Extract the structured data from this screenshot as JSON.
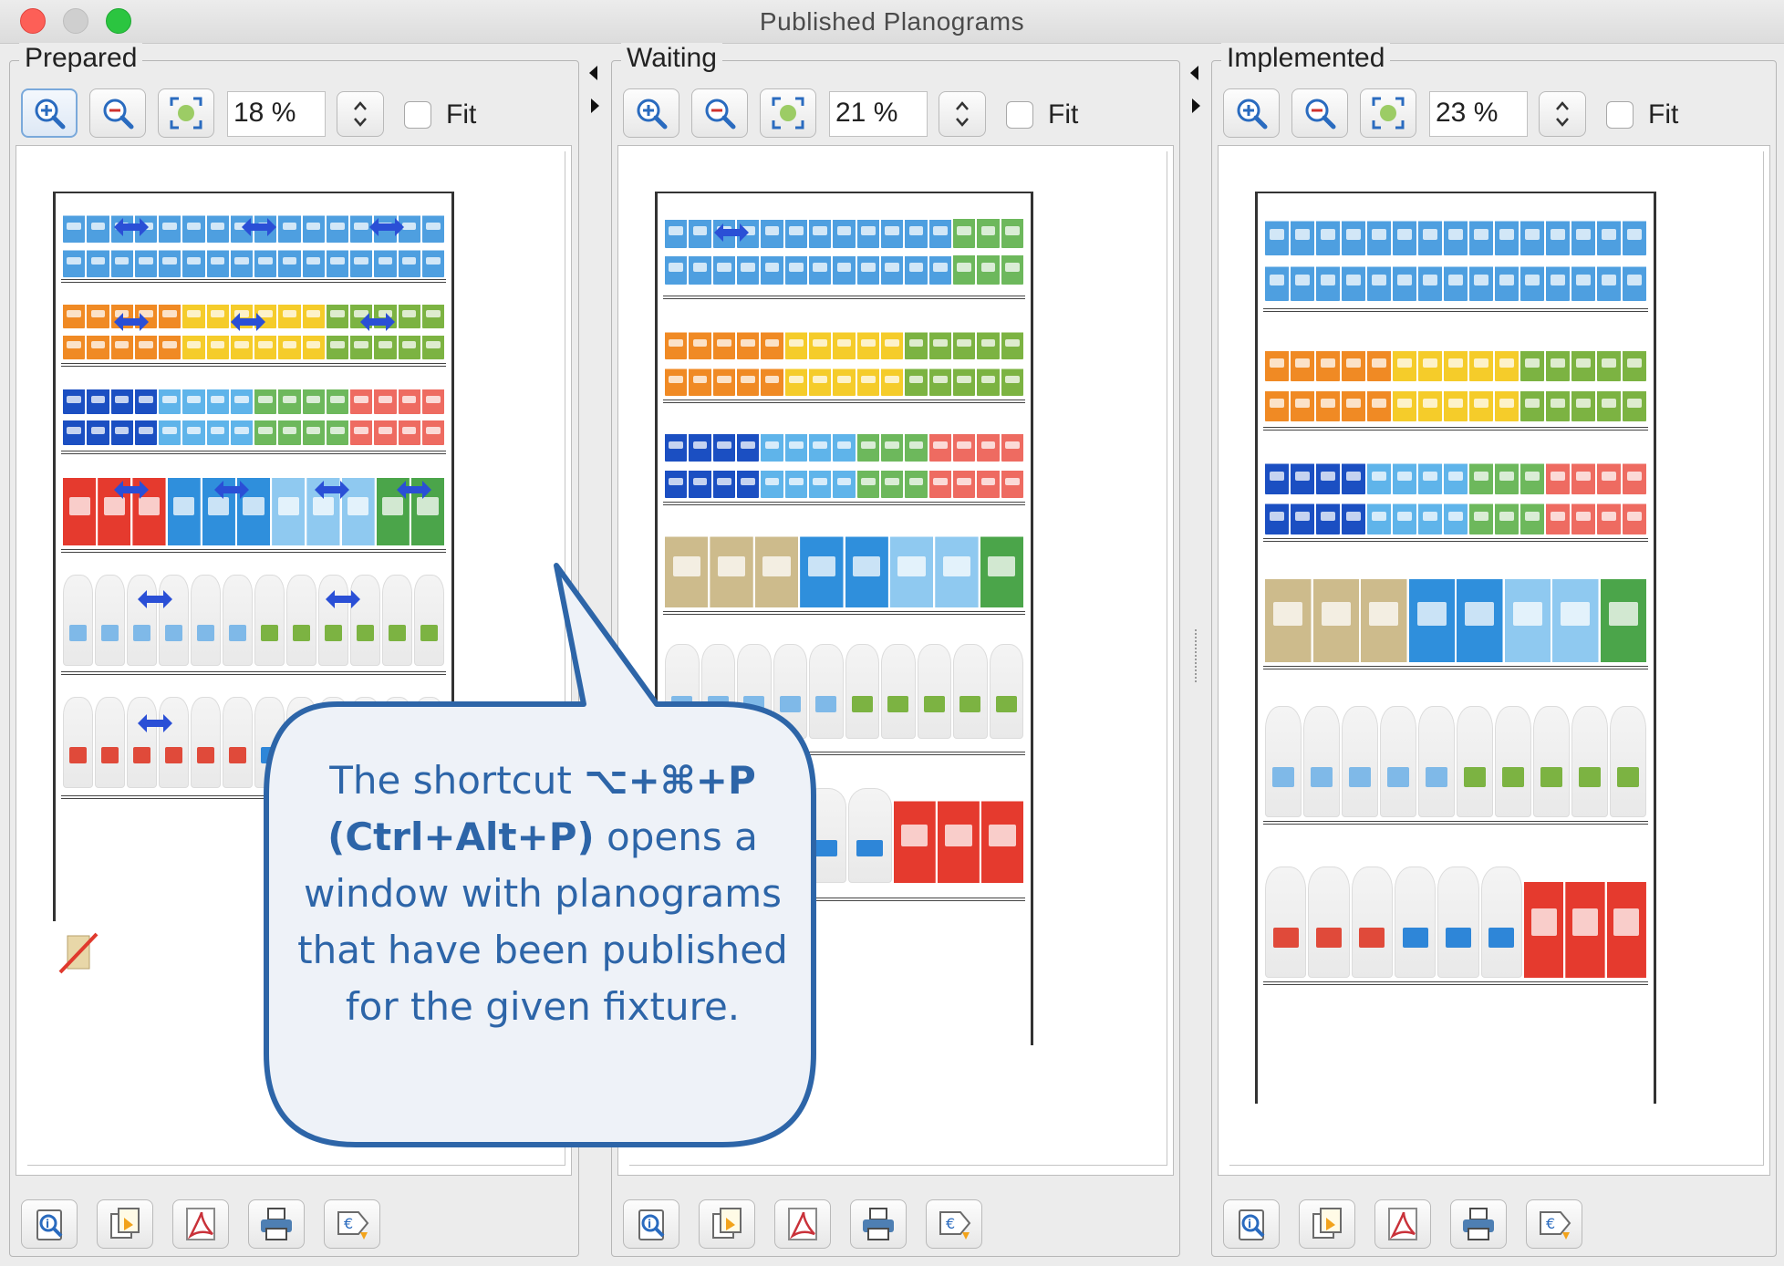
{
  "window": {
    "title": "Published Planograms"
  },
  "panels": [
    {
      "title": "Prepared",
      "zoom": "18 %",
      "fit_label": "Fit"
    },
    {
      "title": "Waiting",
      "zoom": "21 %",
      "fit_label": "Fit"
    },
    {
      "title": "Implemented",
      "zoom": "23 %",
      "fit_label": "Fit"
    }
  ],
  "icons": {
    "zoom_in": "zoom-in-icon",
    "zoom_out": "zoom-out-icon",
    "zoom_fit": "zoom-to-fit-icon",
    "spinner": "stepper-icon",
    "info": "info-icon",
    "copy": "copy-icon",
    "pdf": "pdf-icon",
    "print": "print-icon",
    "price": "euro-price-icon"
  },
  "callout": {
    "part1": "The shortcut ",
    "shortcut": "⌥+⌘+P",
    "newline_shortcut": "(Ctrl+Alt+P)",
    "part2": " opens a window with planograms that have been published for the given fixture."
  },
  "colors": {
    "callout_fill": "#eef2f8",
    "callout_border": "#2d65a8",
    "callout_text": "#2d65a8"
  }
}
